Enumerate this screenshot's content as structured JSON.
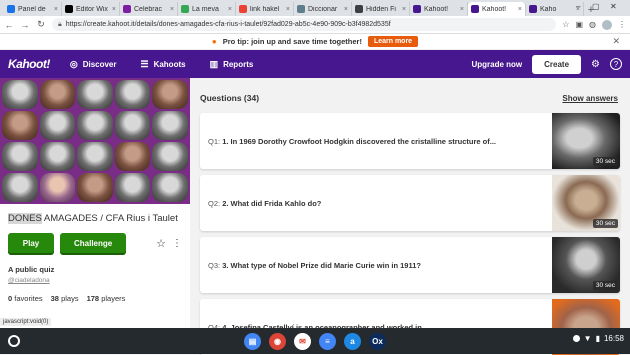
{
  "browser": {
    "tabs": [
      {
        "label": "Panel de",
        "favicon_color": "#1a73e8",
        "favicon": "icon-panel"
      },
      {
        "label": "Editor Wix",
        "favicon_color": "#000000",
        "favicon": "icon-wix"
      },
      {
        "label": "Celebrac",
        "favicon_color": "#7b1fa2",
        "favicon": "icon-doc"
      },
      {
        "label": "La meva",
        "favicon_color": "#34a853",
        "favicon": "icon-drive"
      },
      {
        "label": "link hakel",
        "favicon_color": "#ea4335",
        "favicon": "icon-gmail"
      },
      {
        "label": "Diccionar",
        "favicon_color": "#607d8b",
        "favicon": "icon-doc"
      },
      {
        "label": "Hidden Fi",
        "favicon_color": "#3c4043",
        "favicon": "icon-wiki"
      },
      {
        "label": "Kahoot!",
        "favicon_color": "#46178f",
        "favicon": "icon-kahoot"
      },
      {
        "label": "Kahoot!",
        "favicon_color": "#46178f",
        "favicon": "icon-kahoot",
        "active": true
      },
      {
        "label": "Kaho",
        "favicon_color": "#46178f",
        "favicon": "icon-kahoot"
      }
    ],
    "url": "https://create.kahoot.it/details/dones-amagades-cfa-rius-i-taulet/92fad029-ab5c-4e90-909c-b3f4982d535f"
  },
  "banner": {
    "tip": "Pro tip: join up and save time together!",
    "cta": "Learn more"
  },
  "nav": {
    "logo": "Kahoot!",
    "links": [
      "Discover",
      "Kahoots",
      "Reports"
    ],
    "upgrade": "Upgrade now",
    "create": "Create"
  },
  "quiz": {
    "title_highlight": "DONES",
    "title_rest": " AMAGADES / CFA Rius i Taulet",
    "play": "Play",
    "challenge": "Challenge",
    "visibility": "A public quiz",
    "creator": "@ciadeladona",
    "stats": {
      "favorites": "0",
      "favorites_label": "favorites",
      "plays": "38",
      "plays_label": "plays",
      "players": "178",
      "players_label": "players"
    }
  },
  "questions": {
    "header": "Questions (34)",
    "show_answers": "Show answers",
    "items": [
      {
        "num": "Q1:",
        "text": "1. In 1969 Dorothy Crowfoot Hodgkin discovered the cristalline structure of...",
        "time": "30 sec"
      },
      {
        "num": "Q2:",
        "text": "2. What did Frida Kahlo do?",
        "time": "30 sec"
      },
      {
        "num": "Q3:",
        "text": "3. What type of Nobel Prize did Marie Curie win in 1911?",
        "time": "30 sec"
      },
      {
        "num": "Q4:",
        "text": "4. Josefina Castellví is an oceanographer and worked in...",
        "time": ""
      }
    ]
  },
  "status_text": "javascript:void(0)",
  "shelf": {
    "apps": [
      {
        "name": "files-icon",
        "color": "#4285f4",
        "glyph": "▤"
      },
      {
        "name": "chrome-icon",
        "color": "#db4437",
        "glyph": "◉"
      },
      {
        "name": "gmail-icon",
        "color": "#ffffff",
        "glyph": "✉"
      },
      {
        "name": "docs-icon",
        "color": "#4285f4",
        "glyph": "≡"
      },
      {
        "name": "dictionary-icon",
        "color": "#1e88e5",
        "glyph": "a"
      },
      {
        "name": "oxford-icon",
        "color": "#0d2c5c",
        "glyph": "Ox"
      }
    ],
    "time": "16:58"
  }
}
